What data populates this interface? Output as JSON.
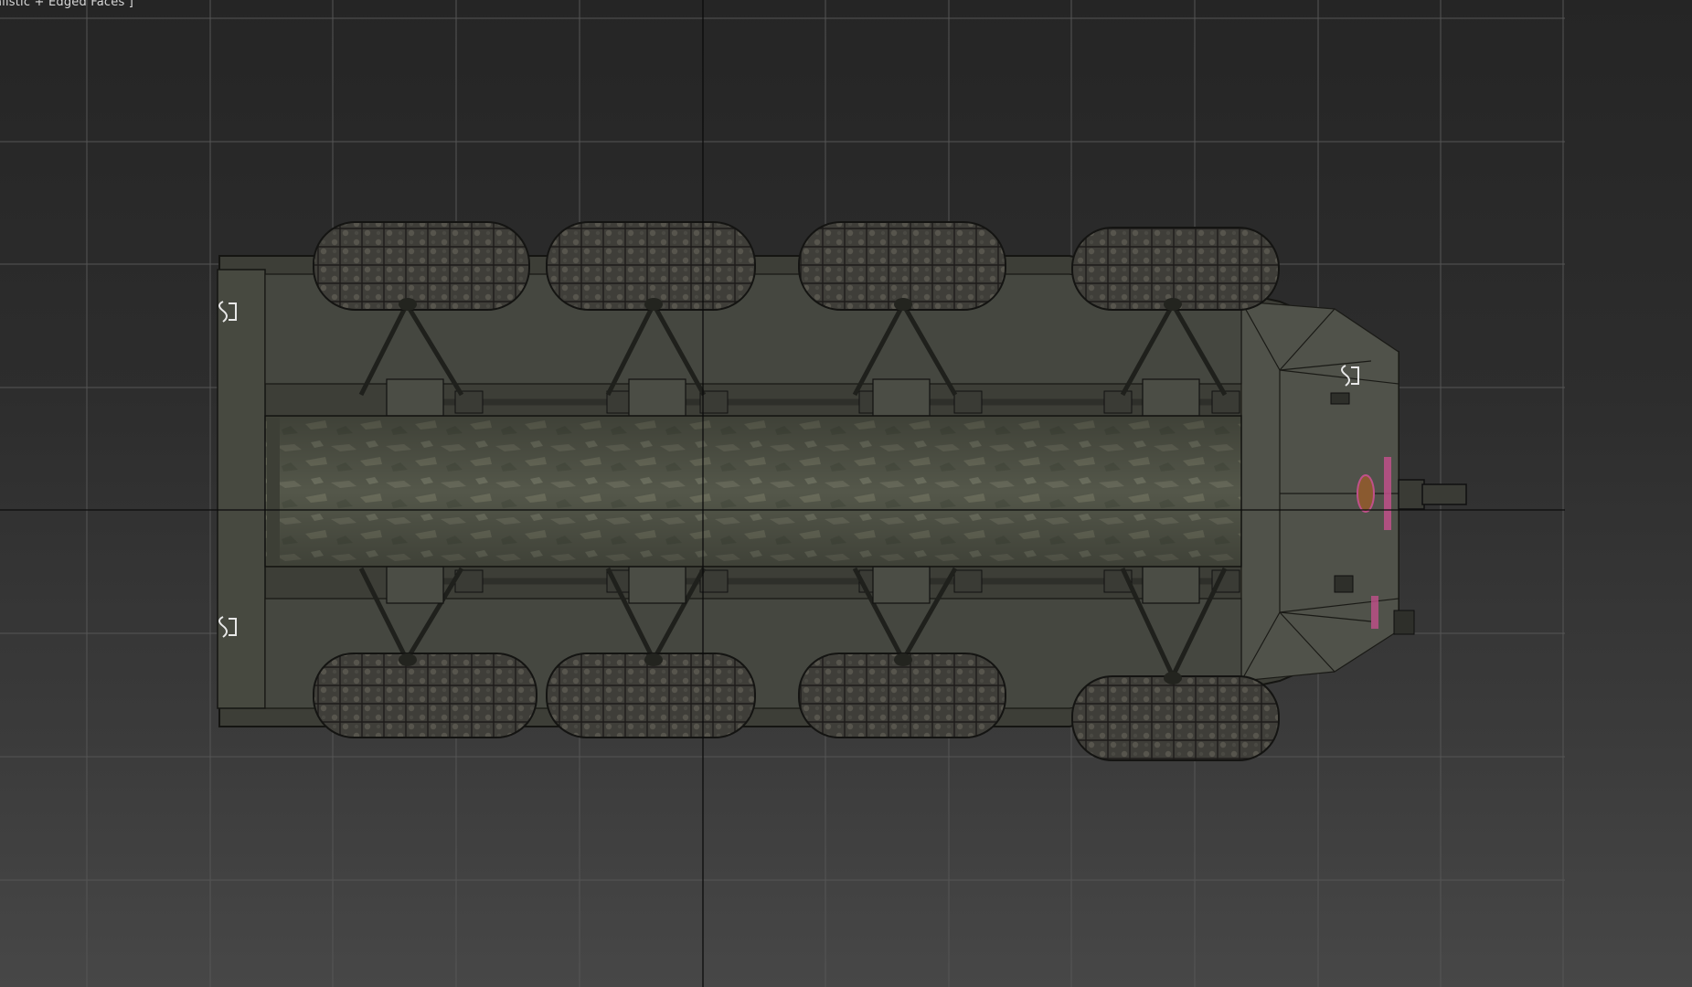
{
  "viewport": {
    "label": "alistic + Edged Faces ]",
    "view": "bottom",
    "colors": {
      "grid_line": "#555555",
      "axis_line": "#0c0c0c",
      "hull_paint": "#5a5c50",
      "tire_rubber": "#3c3b36",
      "suspension": "#2e2f2a",
      "decal_pink": "#c0508a"
    }
  },
  "model": {
    "name": "8x8 armored vehicle",
    "wheel_count": 8,
    "icons": [
      "sheet-metal-clamp-icon",
      "tow-hook-icon"
    ]
  }
}
